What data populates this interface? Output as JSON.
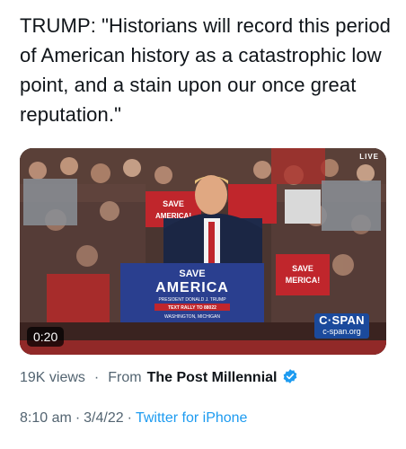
{
  "tweet": {
    "text": "TRUMP:  \"Historians will record this period of American history as a catastrophic low point, and a stain upon our once great reputation.\""
  },
  "media": {
    "live_label": "LIVE",
    "duration": "0:20",
    "network_logo_line1": "C·SPAN",
    "network_logo_line2": "c-span.org",
    "podium_sign": {
      "line1": "SAVE",
      "line2": "AMERICA",
      "line3": "PRESIDENT DONALD J. TRUMP",
      "line4": "TEXT RALLY TO 88022",
      "line5": "WASHINGTON, MICHIGAN"
    },
    "crowd_sign_text": [
      "SAVE",
      "AMERICA!"
    ]
  },
  "stats": {
    "views": "19K views",
    "separator": "·",
    "from_label": "From",
    "source_name": "The Post Millennial"
  },
  "footer": {
    "time": "8:10 am",
    "date": "3/4/22",
    "separator": "·",
    "client": "Twitter for iPhone"
  },
  "colors": {
    "link": "#1d9bf0",
    "verified": "#1d9bf0",
    "sign_blue": "#2a3f8f",
    "sign_red": "#c0262c"
  },
  "icons": {
    "verified": "verified-badge-icon"
  }
}
